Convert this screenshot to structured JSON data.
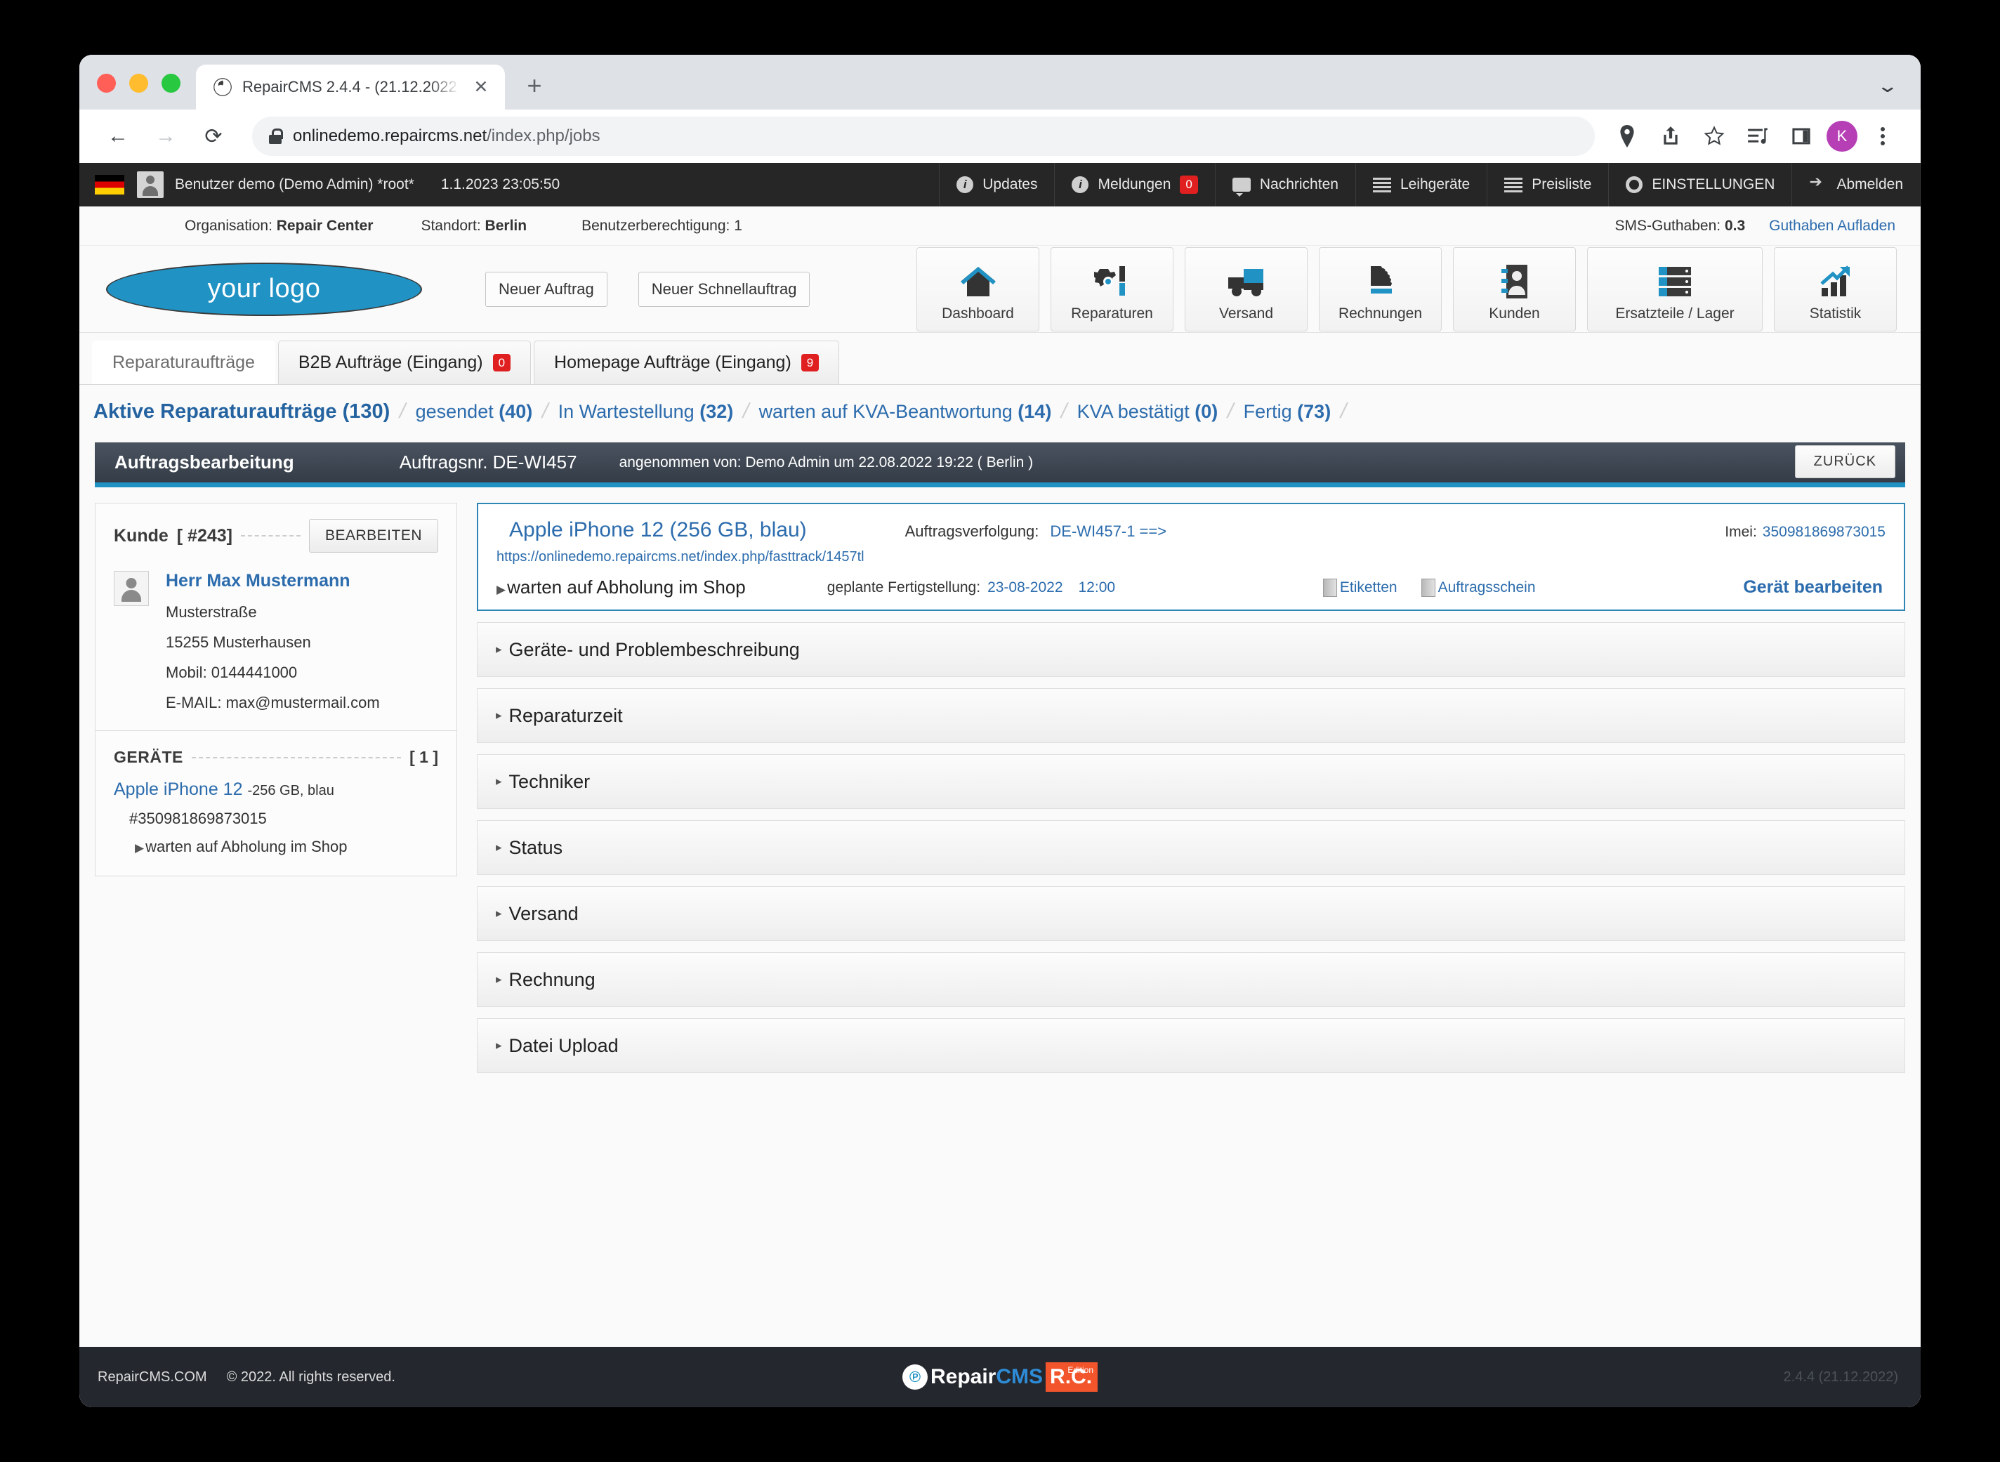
{
  "browser": {
    "tab_title": "RepairCMS 2.4.4 - (21.12.2022",
    "tab_close": "✕",
    "new_tab": "+",
    "back": "←",
    "forward": "→",
    "reload": "⟳",
    "url_host": "onlinedemo.repaircms.net",
    "url_path": "/index.php/jobs",
    "profile_initial": "K",
    "window_chevron": "⌄"
  },
  "appbar": {
    "user": "Benutzer demo (Demo Admin) *root*",
    "datetime": "1.1.2023 23:05:50",
    "items": [
      {
        "label": "Updates",
        "icon": "info-icon",
        "badge": null
      },
      {
        "label": "Meldungen",
        "icon": "info-icon",
        "badge": "0"
      },
      {
        "label": "Nachrichten",
        "icon": "chat-icon",
        "badge": null
      },
      {
        "label": "Leihgeräte",
        "icon": "list-icon",
        "badge": null
      },
      {
        "label": "Preisliste",
        "icon": "list-icon",
        "badge": null
      },
      {
        "label": "EINSTELLUNGEN",
        "icon": "gear-icon",
        "badge": null
      },
      {
        "label": "Abmelden",
        "icon": "logout-icon",
        "badge": null
      }
    ],
    "info_glyph": "i"
  },
  "orgbar": {
    "organisation_label": "Organisation:",
    "organisation_value": "Repair Center",
    "standort_label": "Standort:",
    "standort_value": "Berlin",
    "berechtigung_label": "Benutzerberechtigung:",
    "berechtigung_value": "1",
    "sms_label": "SMS-Guthaben:",
    "sms_value": "0.3",
    "sms_link": "Guthaben Aufladen"
  },
  "toolbar": {
    "logo_text": "your logo",
    "quick_buttons": [
      "Neuer Auftrag",
      "Neuer Schnellauftrag"
    ],
    "tiles": [
      {
        "label": "Dashboard",
        "icon": "home-icon"
      },
      {
        "label": "Reparaturen",
        "icon": "gear-screwdriver-icon"
      },
      {
        "label": "Versand",
        "icon": "truck-icon"
      },
      {
        "label": "Rechnungen",
        "icon": "invoice-icon"
      },
      {
        "label": "Kunden",
        "icon": "contacts-icon"
      },
      {
        "label": "Ersatzteile / Lager",
        "icon": "server-rack-icon"
      },
      {
        "label": "Statistik",
        "icon": "chart-up-icon"
      }
    ]
  },
  "tabs": [
    {
      "label": "Reparaturaufträge",
      "badge": null,
      "active": true
    },
    {
      "label": "B2B Aufträge (Eingang)",
      "badge": "0",
      "active": false
    },
    {
      "label": "Homepage Aufträge (Eingang)",
      "badge": "9",
      "active": false
    }
  ],
  "breadcrumbs": [
    {
      "text": "Aktive Reparaturaufträge",
      "count": "(130)"
    },
    {
      "text": "gesendet",
      "count": "(40)"
    },
    {
      "text": "In Wartestellung",
      "count": "(32)"
    },
    {
      "text": "warten auf KVA-Beantwortung",
      "count": "(14)"
    },
    {
      "text": "KVA bestätigt",
      "count": "(0)"
    },
    {
      "text": "Fertig",
      "count": "(73)"
    }
  ],
  "order": {
    "header_title": "Auftragsbearbeitung",
    "order_no": "Auftragsnr. DE-WI457",
    "accepted_by": "angenommen von: Demo Admin um 22.08.2022 19:22 ( Berlin )",
    "back_button": "ZURÜCK"
  },
  "customer": {
    "title": "Kunde",
    "id": "[ #243]",
    "edit_button": "BEARBEITEN",
    "name": "Herr Max Mustermann",
    "street": "Musterstraße",
    "city": "15255 Musterhausen",
    "mobile": "Mobil: 0144441000",
    "email": "E-MAIL: max@mustermail.com"
  },
  "devices_panel": {
    "title": "GERÄTE",
    "count": "[ 1 ]",
    "device_name": "Apple iPhone 12",
    "device_spec": "-256 GB, blau",
    "device_imei": "#350981869873015",
    "device_status": "warten auf Abholung im Shop",
    "triangle": "▶"
  },
  "device_card": {
    "title": "Apple iPhone 12 (256 GB, blau)",
    "tracking_label": "Auftragsverfolgung:",
    "tracking_value": "DE-WI457-1 ==>",
    "imei_label": "Imei:",
    "imei_value": "350981869873015",
    "fasttrack_url": "https://onlinedemo.repaircms.net/index.php/fasttrack/1457tl",
    "status": "warten auf Abholung im Shop",
    "completion_label": "geplante Fertigstellung:",
    "completion_date": "23-08-2022",
    "completion_time": "12:00",
    "doc_links": [
      "Etiketten",
      "Auftragsschein"
    ],
    "edit_link": "Gerät bearbeiten",
    "triangle": "▶"
  },
  "accordions": [
    "Geräte- und Problembeschreibung",
    "Reparaturzeit",
    "Techniker",
    "Status",
    "Versand",
    "Rechnung",
    "Datei Upload"
  ],
  "accordion_triangle": "▸",
  "footer": {
    "site": "RepairCMS.COM",
    "copyright": "© 2022. All rights reserved.",
    "logo_circle": "℗",
    "logo_repair": "Repair",
    "logo_cms": "CMS",
    "logo_rc": "R.C.",
    "logo_edition": "Edition",
    "version": "2.4.4 (21.12.2022)"
  }
}
